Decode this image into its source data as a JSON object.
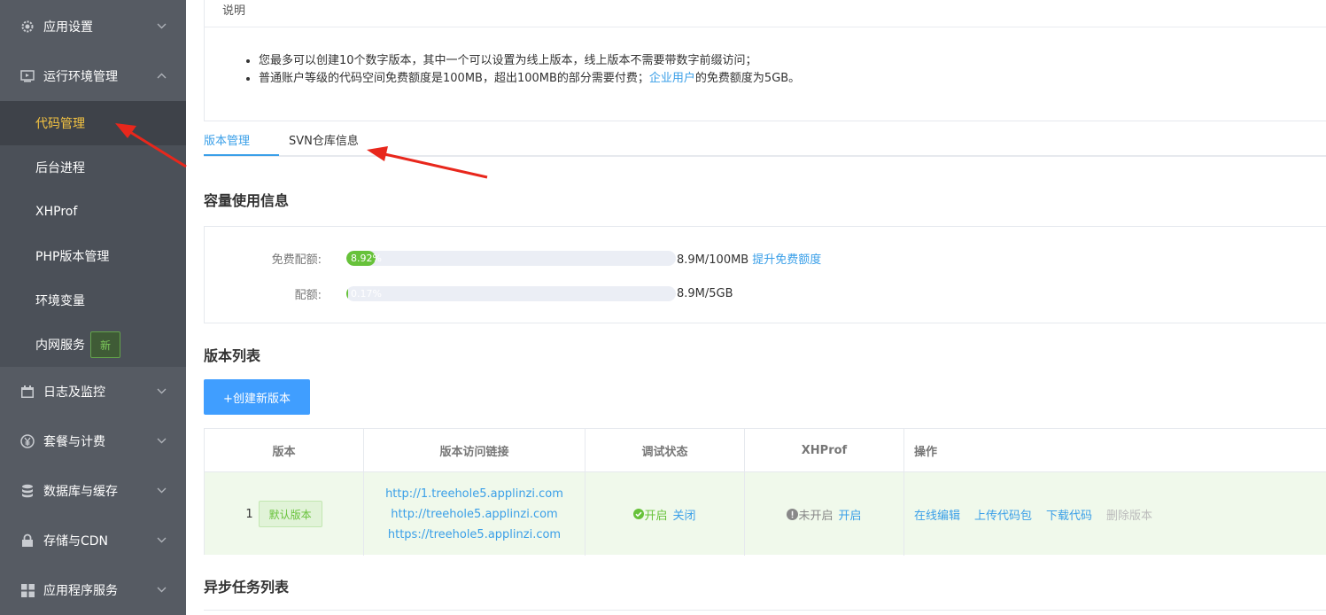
{
  "sidebar": {
    "groups": [
      {
        "label": "应用设置",
        "icon": "gear-icon"
      },
      {
        "label": "运行环境管理",
        "icon": "monitor-icon"
      },
      {
        "label": "日志及监控",
        "icon": "calendar-icon"
      },
      {
        "label": "套餐与计费",
        "icon": "yen-icon"
      },
      {
        "label": "数据库与缓存",
        "icon": "database-icon"
      },
      {
        "label": "存储与CDN",
        "icon": "lock-icon"
      },
      {
        "label": "应用程序服务",
        "icon": "grid-icon"
      }
    ],
    "sub_items": [
      {
        "label": "代码管理"
      },
      {
        "label": "后台进程"
      },
      {
        "label": "XHProf"
      },
      {
        "label": "PHP版本管理"
      },
      {
        "label": "环境变量"
      },
      {
        "label": "内网服务",
        "badge": "新"
      }
    ]
  },
  "notice": {
    "header": "说明",
    "line1": "您最多可以创建10个数字版本，其中一个可以设置为线上版本，线上版本不需要带数字前缀访问；",
    "line2_a": "普通账户等级的代码空间免费额度是100MB，超出100MB的部分需要付费；",
    "line2_link": "企业用户",
    "line2_b": "的免费额度为5GB。"
  },
  "tabs": {
    "version": "版本管理",
    "svn": "SVN仓库信息"
  },
  "capacity": {
    "title": "容量使用信息",
    "free_label": "免费配额:",
    "free_pct_text": "8.92%",
    "free_pct": 8.92,
    "free_value": "8.9M/100MB",
    "upgrade_link": "提升免费额度",
    "quota_label": "配额:",
    "quota_pct_text": "0.17%",
    "quota_pct": 0.17,
    "quota_value": "8.9M/5GB"
  },
  "version_list": {
    "title": "版本列表",
    "create_button": "+创建新版本",
    "headers": {
      "version": "版本",
      "links": "版本访问链接",
      "debug": "调试状态",
      "xhprof": "XHProf",
      "ops": "操作"
    },
    "row": {
      "number": "1",
      "tag": "默认版本",
      "link1": "http://1.treehole5.applinzi.com",
      "link2": "http://treehole5.applinzi.com",
      "link3": "https://treehole5.applinzi.com",
      "debug_status": "开启",
      "debug_action": "关闭",
      "xhprof_status": "未开启",
      "xhprof_action": "开启",
      "op_edit": "在线编辑",
      "op_upload": "上传代码包",
      "op_download": "下载代码",
      "op_delete": "删除版本"
    }
  },
  "async": {
    "title": "异步任务列表"
  },
  "colors": {
    "accent": "#3a9fe8",
    "success": "#67c23a",
    "sidebar": "#565b63",
    "active_text": "#f5c442",
    "arrow": "#e8271c"
  }
}
